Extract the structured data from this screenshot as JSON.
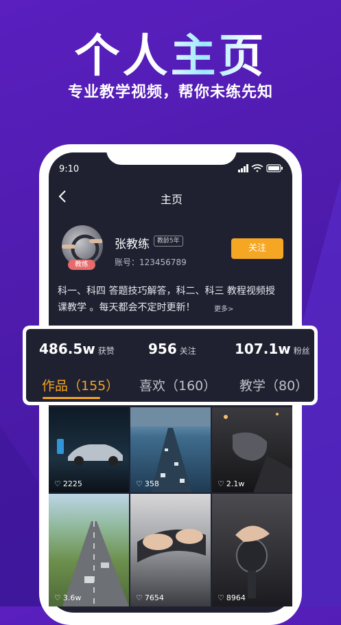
{
  "hero": {
    "title": "个人主页",
    "subtitle": "专业教学视频，帮你未练先知"
  },
  "status_bar": {
    "time": "9:10"
  },
  "nav": {
    "title": "主页"
  },
  "profile": {
    "name": "张教练",
    "experience_tag": "教龄5年",
    "avatar_badge": "教练",
    "account": "账号：123456789",
    "follow_label": "关注",
    "bio": "科一、科四 答题技巧解答，科二、科三 教程视频授课教学 。每天都会不定时更新！",
    "more_label": "更多>"
  },
  "stats": [
    {
      "value": "486.5w",
      "label": "获赞"
    },
    {
      "value": "956",
      "label": "关注"
    },
    {
      "value": "107.1w",
      "label": "粉丝"
    }
  ],
  "tabs": [
    {
      "label": "作品（155）",
      "active": true
    },
    {
      "label": "喜欢（160）",
      "active": false
    },
    {
      "label": "教学（80）",
      "active": false
    }
  ],
  "videos": [
    {
      "likes": "2225",
      "icon": "heart-outline-icon"
    },
    {
      "likes": "358",
      "icon": "heart-outline-icon"
    },
    {
      "likes": "2.1w",
      "icon": "heart-outline-icon"
    },
    {
      "likes": "3.6w",
      "icon": "heart-outline-icon"
    },
    {
      "likes": "7654",
      "icon": "heart-outline-icon"
    },
    {
      "likes": "8964",
      "icon": "heart-outline-icon"
    }
  ],
  "colors": {
    "accent": "#f5a623",
    "background": "#4b1aa8",
    "screen": "#1f2130"
  }
}
